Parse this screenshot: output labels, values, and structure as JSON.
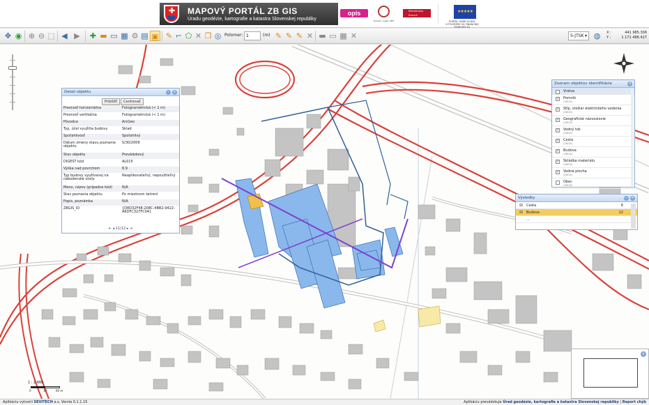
{
  "header": {
    "title": "MAPOVÝ PORTÁL ZB GIS",
    "subtitle": "Úradu geodézie, kartografie a katastra Slovenskej republiky",
    "logo_opis": "opis",
    "seal_caption": "Riadiaci orgán OPIS",
    "ministry_logo": "Ministerstvo financií Slovenskej republiky",
    "eu_caption": "PORTÁL GUBK SA BOL VYTVORENÝ ZA FINANČNEJ PODPORY EÚ",
    "eu_stars": "★★★★★"
  },
  "toolbar": {
    "polomer_label": "Polomer:",
    "polomer_value": "1",
    "unit_label": "(m)",
    "crs_value": "S-JTSK",
    "coord_x_label": "X :",
    "coord_x_value": "441 985.306",
    "coord_y_label": "Y :",
    "coord_y_value": "1 171 486.427",
    "icons": [
      "pan-icon",
      "full-extent-icon",
      "zoom-in-icon",
      "zoom-out-icon",
      "zoom-box-icon",
      "previous-extent-icon",
      "next-extent-icon",
      "identify-icon",
      "measure-icon",
      "print-icon",
      "export-icon",
      "settings-icon",
      "layers-icon",
      "select-icon",
      "edit-icon",
      "draw-line-icon",
      "draw-polygon-icon",
      "delete-icon",
      "copy-icon",
      "buffer-icon",
      "pencil-icon",
      "clear-icon",
      "table-icon",
      "grid-icon",
      "close-icon"
    ]
  },
  "detail_panel": {
    "title": "Detail objektu",
    "btn_show": "Priblížiť",
    "btn_center": "Centrovať",
    "rows": [
      {
        "k": "Presnosť horizontálna",
        "v": "Fotogrametrická (< 1 m)"
      },
      {
        "k": "Presnosť vertikálna",
        "v": "Fotogrametrická (< 1 m)"
      },
      {
        "k": "Pôvodca",
        "v": "ArcGeo"
      },
      {
        "k": "Typ, účel využitia budovy",
        "v": "Sklad"
      },
      {
        "k": "Spoľahlivosť",
        "v": "Spoľahlivý"
      },
      {
        "k": "Dátum zmeny stavu poznania objektu",
        "v": "5/30/2009"
      },
      {
        "k": "Stav objektu",
        "v": "Prevádzkový"
      },
      {
        "k": "DIGEST kód",
        "v": "AL015"
      },
      {
        "k": "Výška nad povrchom",
        "v": "8.9"
      },
      {
        "k": "Typ budovy využívanej na náboženské účely",
        "v": "Neaplikovateľný, nepoužiteľný"
      },
      {
        "k": "Meno, názov (prípadne kód)",
        "v": "N/A"
      },
      {
        "k": "Stav poznania objektu",
        "v": "Po miestnom šetrení"
      },
      {
        "k": "Popis, poznámka",
        "v": "N/A"
      },
      {
        "k": "ZBGIS_ID",
        "v": "{D8D32F48-208C-4BB2-9422-A6DFC327FC04}"
      }
    ],
    "pager": "11/12"
  },
  "objects_panel": {
    "title": "Zoznam objektov identifikácie",
    "header": "Vrstva",
    "items": [
      {
        "name": "Pomník",
        "sub": "(ZBGIS)",
        "checked": true
      },
      {
        "name": "Stĺp, stožiar elektrického vedenia",
        "sub": "(ZBGIS)",
        "checked": true
      },
      {
        "name": "Geografické názvoslovie",
        "sub": "(ZBGIS)",
        "checked": true
      },
      {
        "name": "Vodný tok",
        "sub": "(ZBGIS)",
        "checked": true
      },
      {
        "name": "Cesta",
        "sub": "(ZBGIS)",
        "checked": true
      },
      {
        "name": "Budova",
        "sub": "(ZBGIS)",
        "checked": true
      },
      {
        "name": "Skládka materiálu",
        "sub": "(ZBGIS)",
        "checked": true
      },
      {
        "name": "Vodná plocha",
        "sub": "(ZBGIS)",
        "checked": true
      },
      {
        "name": "Obec",
        "sub": "(ZBGIS)",
        "checked": false
      }
    ]
  },
  "results_panel": {
    "title": "Výsledky",
    "rows": [
      {
        "name": "Cesta",
        "count": "6"
      },
      {
        "name": "Budova",
        "count": "12"
      }
    ],
    "more": "..."
  },
  "scale": {
    "ratio": "1 : 2 660",
    "ticks": [
      "0",
      "30",
      "60 m"
    ]
  },
  "footer": {
    "left_prefix": "Aplikáciu vytvoril",
    "left_company": "SEVITECH",
    "left_suffix": "a.s. Verzia 0.1.1.15",
    "right_prefix": "Aplikáciu prevádzkuje",
    "right_org": "Úrad geodézie, kartografie a katastra Slovenskej republiky",
    "right_link": "Report chýb"
  },
  "colors": {
    "road": "#d9403a",
    "highlight": "#8ab8ec",
    "selection": "#f0c04a",
    "line": "#7a3fd0",
    "building": "#c4c4c4",
    "water": "#2f5f98"
  }
}
